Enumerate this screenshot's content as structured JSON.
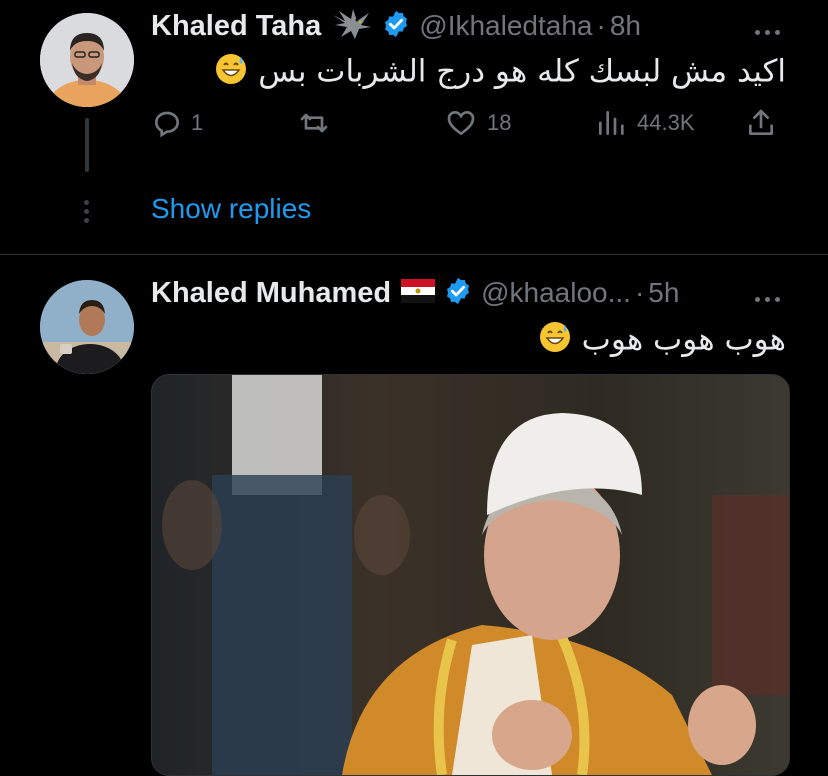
{
  "tweets": [
    {
      "name": "Khaled Taha",
      "handle": "@Ikhaledtaha",
      "separator": "·",
      "time": "8h",
      "text": "اكيد مش لبسك كله هو درج الشربات بس",
      "reply_count": "1",
      "like_count": "18",
      "view_count": "44.3K",
      "name_emoji_icon": "eagle-icon",
      "text_emoji_icon": "grinning-sweat-emoji"
    },
    {
      "name": "Khaled Muhamed",
      "handle": "@khaaloo...",
      "separator": "·",
      "time": "5h",
      "text": "هوب هوب هوب",
      "name_emoji_icon": "egypt-flag-icon",
      "text_emoji_icon": "grinning-sweat-emoji",
      "media_icon": "photo-man-praying"
    }
  ],
  "show_replies": "Show replies",
  "colors": {
    "background": "#000000",
    "text": "#e7e9ea",
    "muted": "#71767b",
    "accent": "#1d9bf0",
    "divider": "#2f3336"
  }
}
